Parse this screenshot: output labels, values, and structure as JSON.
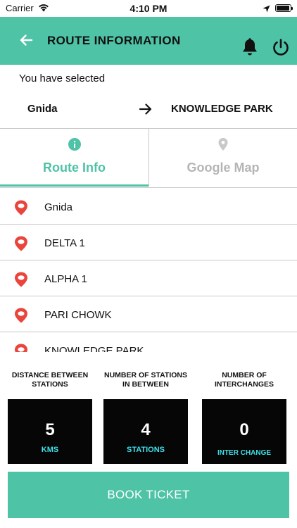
{
  "status_bar": {
    "carrier": "Carrier",
    "time": "4:10 PM",
    "battery_level": 0.95
  },
  "header": {
    "title": "ROUTE INFORMATION",
    "icons": [
      "back-arrow-icon",
      "bell-icon",
      "power-icon"
    ]
  },
  "route": {
    "selected_label": "You have selected",
    "from": "Gnida",
    "to": "KNOWLEDGE PARK"
  },
  "tabs": [
    {
      "label": "Route Info",
      "icon": "info-icon",
      "active": true
    },
    {
      "label": "Google Map",
      "icon": "location-pin-icon",
      "active": false
    }
  ],
  "stations": [
    {
      "name": "Gnida"
    },
    {
      "name": "DELTA 1"
    },
    {
      "name": "ALPHA 1"
    },
    {
      "name": "PARI CHOWK"
    },
    {
      "name": "KNOWLEDGE PARK"
    }
  ],
  "stats": [
    {
      "label": "DISTANCE BETWEEN STATIONS",
      "value": "5",
      "unit": "KMS"
    },
    {
      "label": "NUMBER OF STATIONS IN BETWEEN",
      "value": "4",
      "unit": "STATIONS"
    },
    {
      "label": "NUMBER OF INTERCHANGES",
      "value": "0",
      "unit": "INTER CHANGE"
    }
  ],
  "book_button": {
    "label": "BOOK TICKET"
  },
  "colors": {
    "accent": "#4ec3a6",
    "pin": "#e9453c",
    "stat_unit": "#3fe0ea",
    "stat_box": "#060606"
  }
}
